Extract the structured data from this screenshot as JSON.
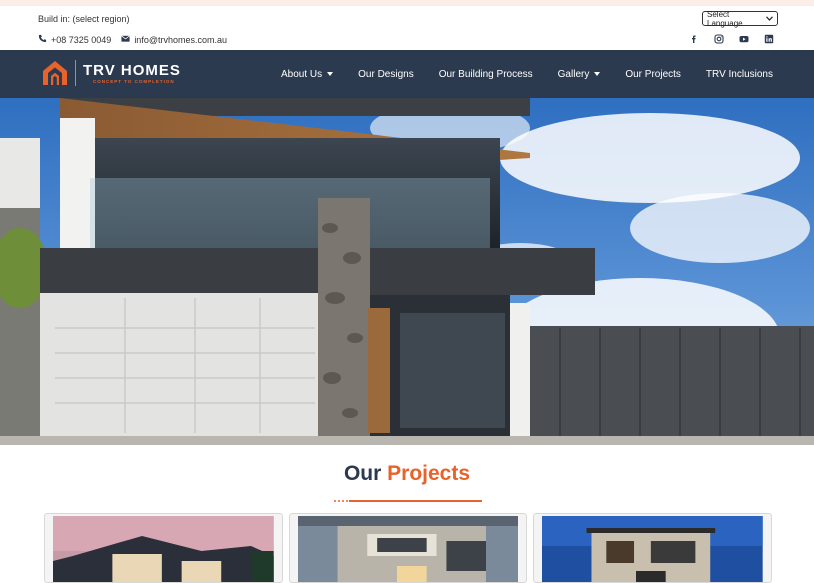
{
  "topbar": {
    "region_text": "Build in: (select region)",
    "phone": "+08 7325 0049",
    "email": "info@trvhomes.com.au",
    "language_select": "Select Language",
    "social": [
      "facebook-icon",
      "instagram-icon",
      "youtube-icon",
      "linkedin-icon"
    ]
  },
  "brand": {
    "name": "TRV HOMES",
    "tagline": "CONCEPT TO COMPLETION",
    "colors": {
      "navy": "#2c3a4f",
      "accent": "#e8622b"
    }
  },
  "nav": {
    "items": [
      {
        "label": "About Us",
        "dropdown": true
      },
      {
        "label": "Our Designs",
        "dropdown": false
      },
      {
        "label": "Our Building Process",
        "dropdown": false
      },
      {
        "label": "Gallery",
        "dropdown": true
      },
      {
        "label": "Our Projects",
        "dropdown": false
      },
      {
        "label": "TRV Inclusions",
        "dropdown": false
      }
    ]
  },
  "projects": {
    "title_part1": "Our",
    "title_part2": "Projects",
    "cards": 3
  }
}
